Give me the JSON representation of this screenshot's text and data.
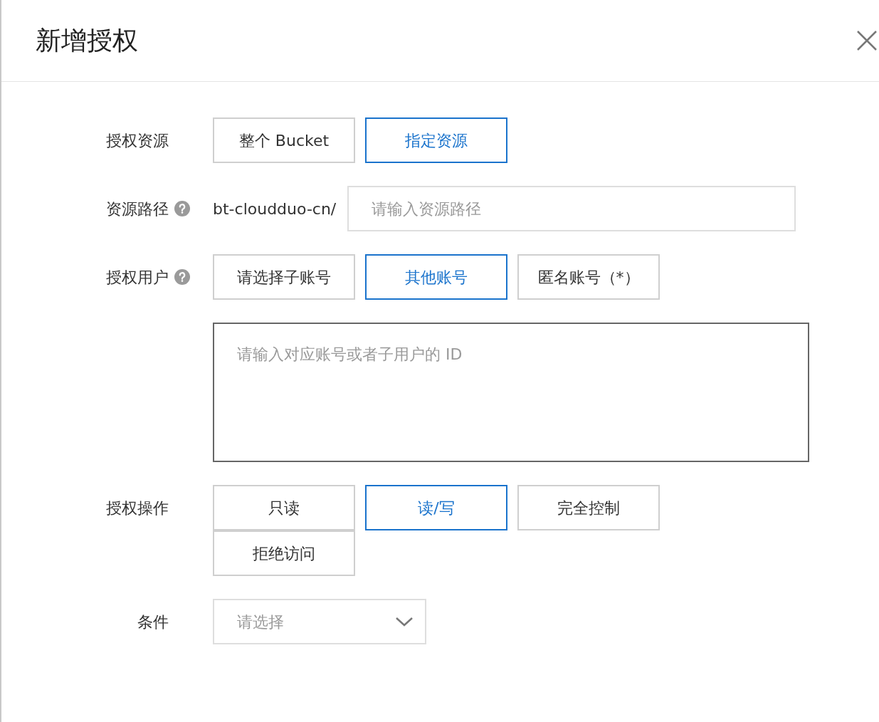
{
  "dialog": {
    "title": "新增授权"
  },
  "resource": {
    "label": "授权资源",
    "options": [
      {
        "label": "整个 Bucket",
        "selected": false
      },
      {
        "label": "指定资源",
        "selected": true
      }
    ]
  },
  "path": {
    "label": "资源路径",
    "prefix": "bt-cloudduo-cn/",
    "placeholder": "请输入资源路径"
  },
  "user": {
    "label": "授权用户",
    "options": [
      {
        "label": "请选择子账号",
        "selected": false
      },
      {
        "label": "其他账号",
        "selected": true
      },
      {
        "label": "匿名账号（*）",
        "selected": false
      }
    ],
    "id_field": {
      "placeholder": "请输入对应账号或者子用户的 ID",
      "focused": true
    }
  },
  "operation": {
    "label": "授权操作",
    "options": [
      {
        "label": "只读",
        "selected": false
      },
      {
        "label": "读/写",
        "selected": true
      },
      {
        "label": "完全控制",
        "selected": false
      },
      {
        "label": "拒绝访问",
        "selected": false
      }
    ]
  },
  "condition": {
    "label": "条件",
    "placeholder": "请选择"
  }
}
